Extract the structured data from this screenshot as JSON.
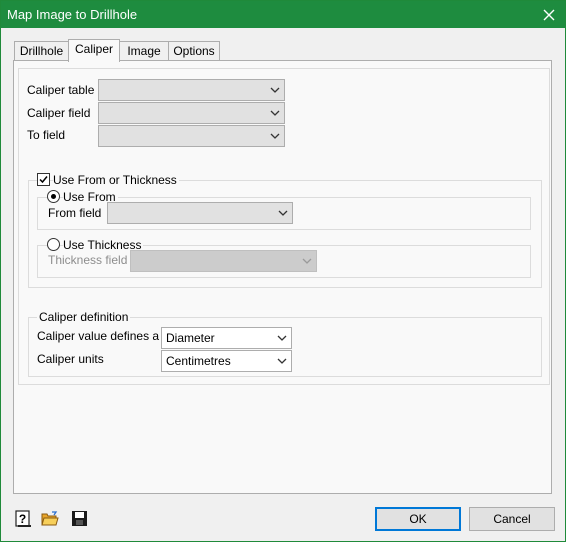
{
  "window": {
    "title": "Map Image to Drillhole"
  },
  "tabs": [
    {
      "label": "Drillhole"
    },
    {
      "label": "Caliper"
    },
    {
      "label": "Image"
    },
    {
      "label": "Options"
    }
  ],
  "caliper_fields": {
    "caliper_table_label": "Caliper table",
    "caliper_table_value": "",
    "caliper_field_label": "Caliper field",
    "caliper_field_value": "",
    "to_field_label": "To field",
    "to_field_value": ""
  },
  "from_thickness": {
    "checkbox_label": "Use From or Thickness",
    "checked": true,
    "use_from_label": "Use From",
    "use_from_selected": true,
    "from_field_label": "From field",
    "from_field_value": "",
    "use_thickness_label": "Use Thickness",
    "use_thickness_selected": false,
    "thickness_field_label": "Thickness field",
    "thickness_field_value": ""
  },
  "caliper_definition": {
    "group_label": "Caliper definition",
    "value_defines_label": "Caliper value defines a",
    "value_defines_value": "Diameter",
    "units_label": "Caliper units",
    "units_value": "Centimetres"
  },
  "footer": {
    "ok_label": "OK",
    "cancel_label": "Cancel",
    "icons": [
      "help-icon",
      "open-folder-icon",
      "save-icon"
    ]
  }
}
